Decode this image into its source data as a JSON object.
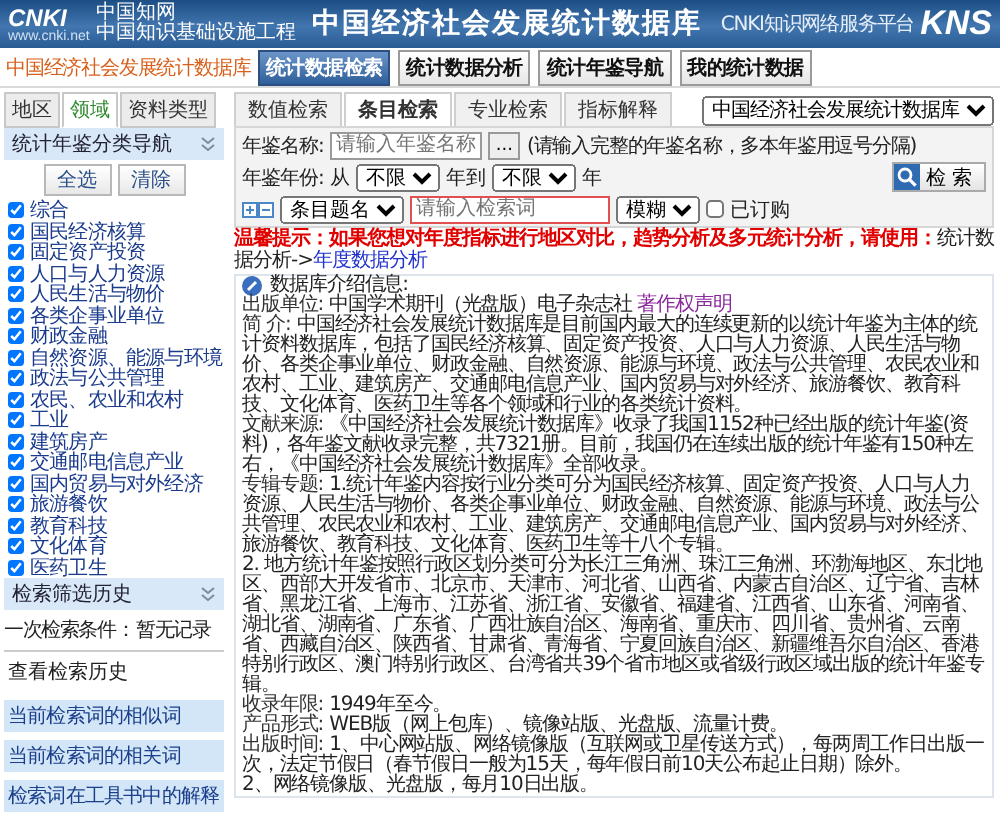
{
  "header": {
    "logo_mark": "CNKI",
    "logo_name": "中国知网",
    "logo_url": "www.cnki.net",
    "logo_tagline": "中国知识基础设施工程",
    "title": "中国经济社会发展统计数据库",
    "platform": "CNKI知识网络服务平台",
    "brand": "KNS"
  },
  "nav": {
    "title": "中国经济社会发展统计数据库",
    "buttons": [
      {
        "label": "统计数据检索",
        "selected": true
      },
      {
        "label": "统计数据分析",
        "selected": false
      },
      {
        "label": "统计年鉴导航",
        "selected": false
      },
      {
        "label": "我的统计数据",
        "selected": false
      }
    ],
    "database": "中国经济社会发展统计数据库"
  },
  "sidebar": {
    "tabs": [
      {
        "label": "地区",
        "selected": false
      },
      {
        "label": "领域",
        "selected": true
      },
      {
        "label": "资料类型",
        "selected": false
      }
    ],
    "category_header": "统计年鉴分类导航",
    "select_all": "全选",
    "clear": "清除",
    "categories": [
      {
        "label": "综合",
        "checked": true
      },
      {
        "label": "国民经济核算",
        "checked": true
      },
      {
        "label": "固定资产投资",
        "checked": true
      },
      {
        "label": "人口与人力资源",
        "checked": true
      },
      {
        "label": "人民生活与物价",
        "checked": true
      },
      {
        "label": "各类企事业单位",
        "checked": true
      },
      {
        "label": "财政金融",
        "checked": true
      },
      {
        "label": "自然资源、能源与环境",
        "checked": true
      },
      {
        "label": "政法与公共管理",
        "checked": true
      },
      {
        "label": "农民、农业和农村",
        "checked": true
      },
      {
        "label": "工业",
        "checked": true
      },
      {
        "label": "建筑房产",
        "checked": true
      },
      {
        "label": "交通邮电信息产业",
        "checked": true
      },
      {
        "label": "国内贸易与对外经济",
        "checked": true
      },
      {
        "label": "旅游餐饮",
        "checked": true
      },
      {
        "label": "教育科技",
        "checked": true
      },
      {
        "label": "文化体育",
        "checked": true
      },
      {
        "label": "医药卫生",
        "checked": true
      }
    ],
    "history_header": "检索筛选历史",
    "condition_label": "一次检索条件：",
    "condition_value": "暂无记录",
    "view_history": "查看检索历史",
    "links": [
      "当前检索词的相似词",
      "当前检索词的相关词",
      "检索词在工具书中的解释"
    ]
  },
  "search": {
    "tabs": [
      {
        "label": "数值检索",
        "selected": false
      },
      {
        "label": "条目检索",
        "selected": true
      },
      {
        "label": "专业检索",
        "selected": false
      },
      {
        "label": "指标解释",
        "selected": false
      }
    ],
    "yearbook_label": "年鉴名称:",
    "yearbook_placeholder": "请输入年鉴名称",
    "browse_button": "...",
    "yearbook_hint": "(请输入完整的年鉴名称，多本年鉴用逗号分隔)",
    "year_label": "年鉴年份:",
    "year_from": "从",
    "year_start": "不限",
    "year_mid": "年到",
    "year_end": "不限",
    "year_suffix": "年",
    "field": "条目题名",
    "keyword_placeholder": "请输入检索词",
    "match": "模糊",
    "subscribed_label": "已订购",
    "subscribed": false,
    "search_button": "检 索"
  },
  "notice": {
    "text": "温馨提示：如果您想对年度指标进行地区对比，趋势分析及多元统计分析，请使用：",
    "path": "统计数据分析->",
    "link": "年度数据分析"
  },
  "info": {
    "title": "数据库介绍信息:",
    "items": [
      {
        "label": "出版单位:",
        "paragraphs": [
          "中国学术期刊（光盘版）电子杂志社"
        ],
        "link": "著作权声明"
      },
      {
        "label": "简 介:",
        "paragraphs": [
          "中国经济社会发展统计数据库是目前国内最大的连续更新的以统计年鉴为主体的统计资料数据库，包括了国民经济核算、固定资产投资、人口与人力资源、人民生活与物价、各类企事业单位、财政金融、自然资源、能源与环境、政法与公共管理、农民农业和农村、工业、建筑房产、交通邮电信息产业、国内贸易与对外经济、旅游餐饮、教育科技、文化体育、医药卫生等各个领域和行业的各类统计资料。"
        ]
      },
      {
        "label": "文献来源:",
        "paragraphs": [
          "《中国经济社会发展统计数据库》收录了我国1152种已经出版的统计年鉴(资料)，各年鉴文献收录完整，共7321册。目前，我国仍在连续出版的统计年鉴有150种左右，《中国经济社会发展统计数据库》全部收录。"
        ]
      },
      {
        "label": "专辑专题:",
        "paragraphs": [
          "1.统计年鉴内容按行业分类可分为国民经济核算、固定资产投资、人口与人力资源、人民生活与物价、各类企事业单位、财政金融、自然资源、能源与环境、政法与公共管理、农民农业和农村、工业、建筑房产、交通邮电信息产业、国内贸易与对外经济、旅游餐饮、教育科技、文化体育、医药卫生等十八个专辑。",
          "2. 地方统计年鉴按照行政区划分类可分为长江三角洲、珠江三角洲、环渤海地区、东北地区、西部大开发省市、北京市、天津市、河北省、山西省、内蒙古自治区、辽宁省、吉林省、黑龙江省、上海市、江苏省、浙江省、安徽省、福建省、江西省、山东省、河南省、湖北省、湖南省、广东省、广西壮族自治区、海南省、重庆市、四川省、贵州省、云南省、西藏自治区、陕西省、甘肃省、青海省、宁夏回族自治区、新疆维吾尔自治区、香港特别行政区、澳门特别行政区、台湾省共39个省市地区或省级行政区域出版的统计年鉴专辑。"
        ]
      },
      {
        "label": "收录年限:",
        "paragraphs": [
          "1949年至今。"
        ]
      },
      {
        "label": "产品形式:",
        "paragraphs": [
          "WEB版（网上包库）、镜像站版、光盘版、流量计费。"
        ]
      },
      {
        "label": "出版时间:",
        "paragraphs": [
          "1、中心网站版、网络镜像版（互联网或卫星传送方式），每两周工作日出版一次，法定节假日（春节假日一般为15天，每年假日前10天公布起止日期）除外。",
          "2、网络镜像版、光盘版，每月10日出版。"
        ]
      }
    ]
  }
}
